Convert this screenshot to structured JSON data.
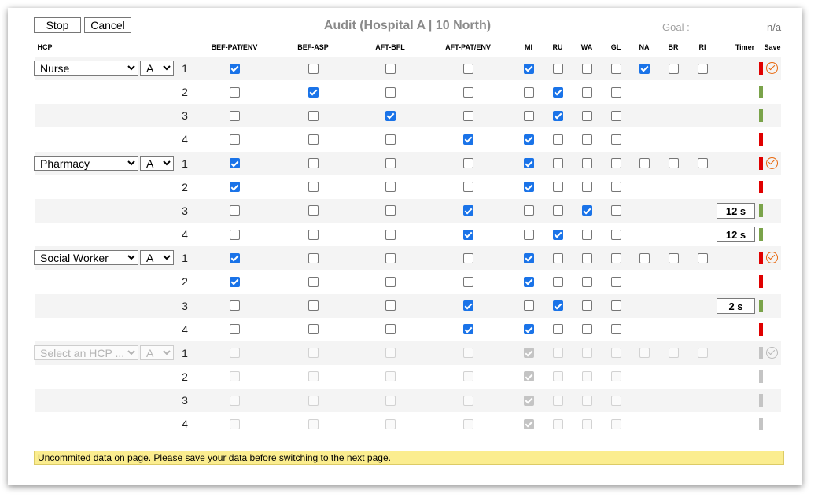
{
  "toolbar": {
    "stop_label": "Stop",
    "cancel_label": "Cancel"
  },
  "title": "Audit (Hospital A | 10 North)",
  "goal": {
    "label": "Goal :",
    "value": "n/a"
  },
  "columns": {
    "hcp": "HCP",
    "timer": "Timer",
    "save": "Save"
  },
  "indicators": [
    "BEF-PAT/ENV",
    "BEF-ASP",
    "AFT-BFL",
    "AFT-PAT/ENV"
  ],
  "actions": [
    "MI",
    "RU",
    "WA",
    "GL"
  ],
  "extras": [
    "NA",
    "BR",
    "RI"
  ],
  "colors": {
    "bar_red": "#e00000",
    "bar_green": "#7aa34a",
    "bar_grey": "#c4c4c4",
    "save_orange": "#e8650a",
    "checkbox_blue": "#1a73e8",
    "notice_yellow": "#fbed8f"
  },
  "groups": [
    {
      "hcp": "Nurse",
      "grade": "A",
      "disabled": false,
      "extras": [
        true,
        false,
        false
      ],
      "rows": [
        {
          "num": "1",
          "ind": [
            true,
            false,
            false,
            false
          ],
          "act": [
            true,
            false,
            false,
            false
          ],
          "timer": "",
          "status": "red"
        },
        {
          "num": "2",
          "ind": [
            false,
            true,
            false,
            false
          ],
          "act": [
            false,
            true,
            false,
            false
          ],
          "timer": "",
          "status": "green"
        },
        {
          "num": "3",
          "ind": [
            false,
            false,
            true,
            false
          ],
          "act": [
            false,
            true,
            false,
            false
          ],
          "timer": "",
          "status": "green"
        },
        {
          "num": "4",
          "ind": [
            false,
            false,
            false,
            true
          ],
          "act": [
            true,
            false,
            false,
            false
          ],
          "timer": "",
          "status": "red"
        }
      ]
    },
    {
      "hcp": "Pharmacy",
      "grade": "A",
      "disabled": false,
      "extras": [
        false,
        false,
        false
      ],
      "rows": [
        {
          "num": "1",
          "ind": [
            true,
            false,
            false,
            false
          ],
          "act": [
            true,
            false,
            false,
            false
          ],
          "timer": "",
          "status": "red"
        },
        {
          "num": "2",
          "ind": [
            true,
            false,
            false,
            false
          ],
          "act": [
            true,
            false,
            false,
            false
          ],
          "timer": "",
          "status": "red"
        },
        {
          "num": "3",
          "ind": [
            false,
            false,
            false,
            true
          ],
          "act": [
            false,
            false,
            true,
            false
          ],
          "timer": "12 s",
          "status": "green"
        },
        {
          "num": "4",
          "ind": [
            false,
            false,
            false,
            true
          ],
          "act": [
            false,
            true,
            false,
            false
          ],
          "timer": "12 s",
          "status": "green"
        }
      ]
    },
    {
      "hcp": "Social Worker",
      "grade": "A",
      "disabled": false,
      "extras": [
        false,
        false,
        false
      ],
      "rows": [
        {
          "num": "1",
          "ind": [
            true,
            false,
            false,
            false
          ],
          "act": [
            true,
            false,
            false,
            false
          ],
          "timer": "",
          "status": "red"
        },
        {
          "num": "2",
          "ind": [
            true,
            false,
            false,
            false
          ],
          "act": [
            true,
            false,
            false,
            false
          ],
          "timer": "",
          "status": "red"
        },
        {
          "num": "3",
          "ind": [
            false,
            false,
            false,
            true
          ],
          "act": [
            false,
            true,
            false,
            false
          ],
          "timer": "2 s",
          "status": "green"
        },
        {
          "num": "4",
          "ind": [
            false,
            false,
            false,
            true
          ],
          "act": [
            true,
            false,
            false,
            false
          ],
          "timer": "",
          "status": "red"
        }
      ]
    },
    {
      "hcp": "Select an HCP ...",
      "grade": "A",
      "disabled": true,
      "extras": [
        false,
        false,
        false
      ],
      "rows": [
        {
          "num": "1",
          "ind": [
            false,
            false,
            false,
            false
          ],
          "act": [
            true,
            false,
            false,
            false
          ],
          "timer": "",
          "status": "grey"
        },
        {
          "num": "2",
          "ind": [
            false,
            false,
            false,
            false
          ],
          "act": [
            true,
            false,
            false,
            false
          ],
          "timer": "",
          "status": "grey"
        },
        {
          "num": "3",
          "ind": [
            false,
            false,
            false,
            false
          ],
          "act": [
            true,
            false,
            false,
            false
          ],
          "timer": "",
          "status": "grey"
        },
        {
          "num": "4",
          "ind": [
            false,
            false,
            false,
            false
          ],
          "act": [
            true,
            false,
            false,
            false
          ],
          "timer": "",
          "status": "grey"
        }
      ]
    }
  ],
  "notice": "Uncommited data on page. Please save your data before switching to the next page."
}
